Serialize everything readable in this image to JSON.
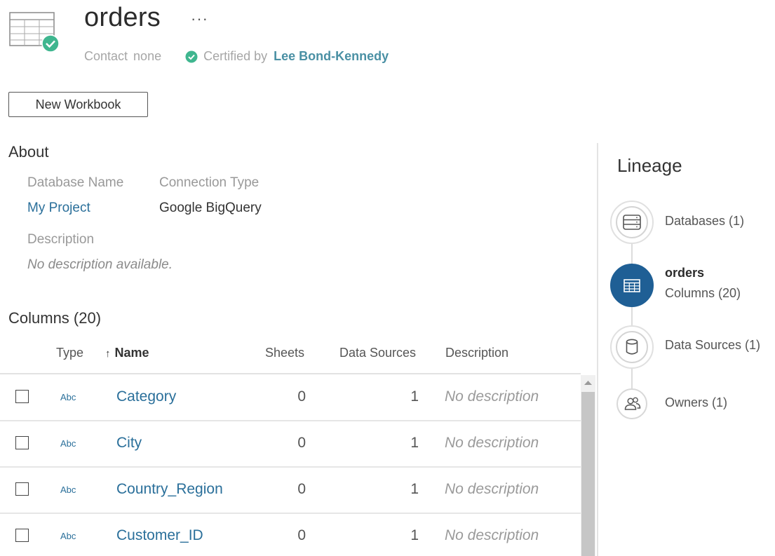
{
  "header": {
    "title": "orders",
    "more": "···",
    "contact_label": "Contact",
    "contact_value": "none",
    "certified_label": "Certified by",
    "certifier": "Lee Bond-Kennedy",
    "icon": "table-certified-icon",
    "cert_icon": "check-circle-icon",
    "accent_color": "#3fb68f"
  },
  "actions": {
    "new_workbook": "New Workbook"
  },
  "about": {
    "title": "About",
    "database_name_label": "Database Name",
    "database_name_value": "My Project",
    "connection_type_label": "Connection Type",
    "connection_type_value": "Google BigQuery",
    "description_label": "Description",
    "description_value": "No description available."
  },
  "columns": {
    "title": "Columns (20)",
    "headers": {
      "type": "Type",
      "sort_arrow": "↑",
      "name": "Name",
      "sheets": "Sheets",
      "data_sources": "Data Sources",
      "description": "Description"
    },
    "rows": [
      {
        "type": "Abc",
        "name": "Category",
        "sheets": "0",
        "data_sources": "1",
        "description": "No description"
      },
      {
        "type": "Abc",
        "name": "City",
        "sheets": "0",
        "data_sources": "1",
        "description": "No description"
      },
      {
        "type": "Abc",
        "name": "Country_Region",
        "sheets": "0",
        "data_sources": "1",
        "description": "No description"
      },
      {
        "type": "Abc",
        "name": "Customer_ID",
        "sheets": "0",
        "data_sources": "1",
        "description": "No description"
      }
    ]
  },
  "lineage": {
    "title": "Lineage",
    "nodes": [
      {
        "label": "Databases (1)",
        "icon": "database-icon"
      },
      {
        "label": "orders",
        "sublabel": "Columns (20)",
        "icon": "table-icon",
        "active": true
      },
      {
        "label": "Data Sources (1)",
        "icon": "cylinder-icon"
      },
      {
        "label": "Owners (1)",
        "icon": "users-icon"
      }
    ],
    "active_color": "#1f5f95"
  }
}
